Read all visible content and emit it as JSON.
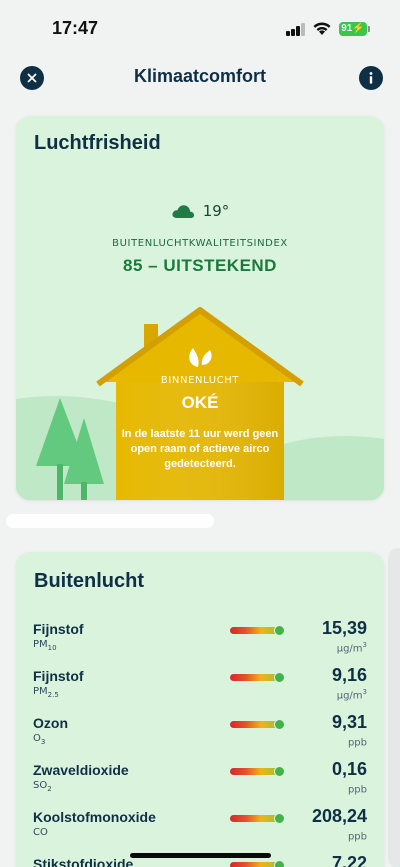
{
  "status_bar": {
    "time": "17:47",
    "battery": "91"
  },
  "header": {
    "title": "Klimaatcomfort",
    "close_icon": "close-icon",
    "info_icon": "info-icon"
  },
  "air_freshness": {
    "title": "Luchtfrisheid",
    "weather_icon": "cloud-icon",
    "temperature": "19°",
    "index_label": "BUITENLUCHTKWALITEITSINDEX",
    "index_value": "85 – UITSTEKEND",
    "indoor_label": "BINNENLUCHT",
    "indoor_status": "OKÉ",
    "indoor_message": "In de laatste 11 uur werd geen open raam of actieve airco gedetecteerd.",
    "colors": {
      "card": "#daf3dd",
      "house": "#e6b800",
      "index": "#1a7a3c",
      "tree": "#6fcf8a"
    }
  },
  "outdoor": {
    "title": "Buitenlucht",
    "pollutants": [
      {
        "name": "Fijnstof",
        "formula_base": "PM",
        "formula_sub": "10",
        "value": "15,39",
        "unit_base": "µg/m",
        "unit_sup": "3",
        "level": 0.95
      },
      {
        "name": "Fijnstof",
        "formula_base": "PM",
        "formula_sub": "2.5",
        "value": "9,16",
        "unit_base": "µg/m",
        "unit_sup": "3",
        "level": 0.95
      },
      {
        "name": "Ozon",
        "formula_base": "O",
        "formula_sub": "3",
        "value": "9,31",
        "unit_base": "ppb",
        "unit_sup": "",
        "level": 0.95
      },
      {
        "name": "Zwaveldioxide",
        "formula_base": "SO",
        "formula_sub": "2",
        "value": "0,16",
        "unit_base": "ppb",
        "unit_sup": "",
        "level": 0.95
      },
      {
        "name": "Koolstofmonoxide",
        "formula_base": "CO",
        "formula_sub": "",
        "value": "208,24",
        "unit_base": "ppb",
        "unit_sup": "",
        "level": 0.95
      },
      {
        "name": "Stikstofdioxide",
        "formula_base": "",
        "formula_sub": "",
        "value": "7,22",
        "unit_base": "",
        "unit_sup": "",
        "level": 0.95
      }
    ],
    "colors": {
      "gauge_dot": "#43b24a"
    }
  }
}
